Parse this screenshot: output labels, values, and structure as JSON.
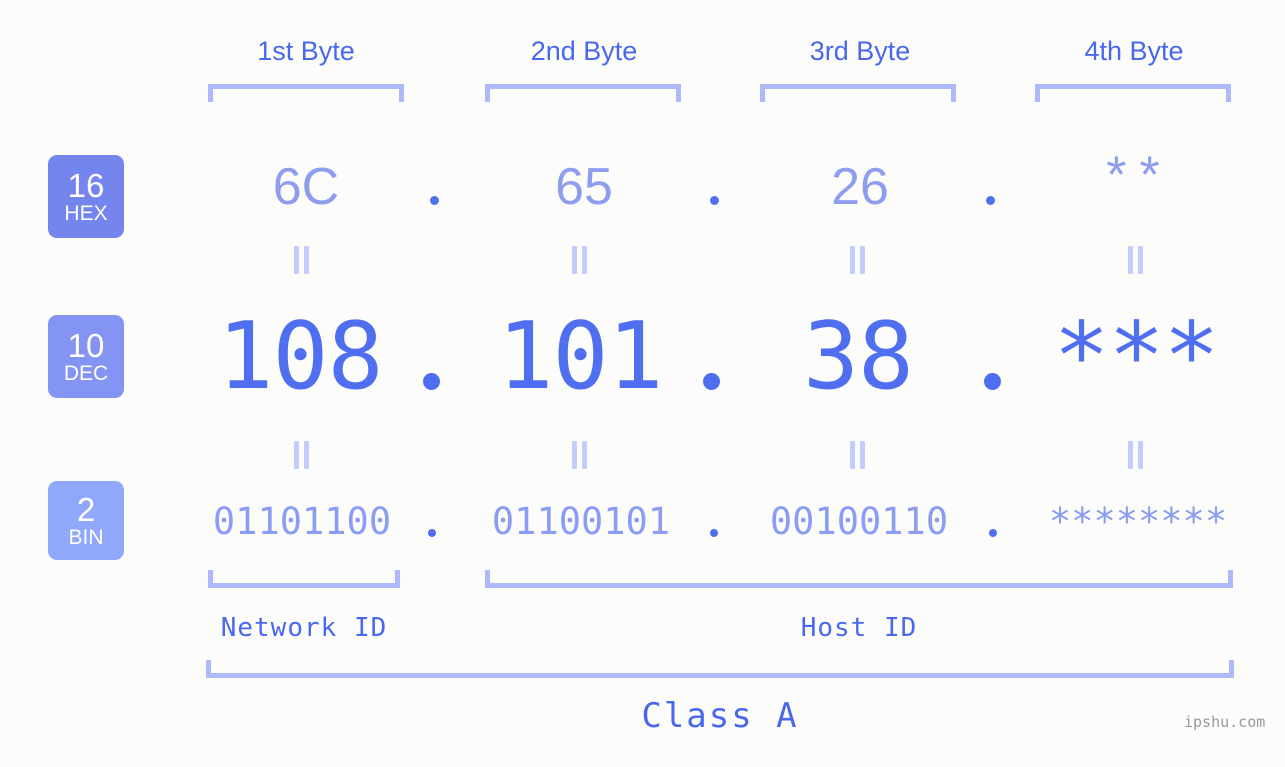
{
  "background_color": "#fcfdfa",
  "accent_color": "#4a68ee",
  "bracket_color": "#aeb9fb",
  "byte_headers": [
    {
      "label": "1st Byte"
    },
    {
      "label": "2nd Byte"
    },
    {
      "label": "3rd Byte"
    },
    {
      "label": "4th Byte"
    }
  ],
  "rows": {
    "hex": {
      "badge_number": "16",
      "badge_name": "HEX",
      "badge_color": "#7486ed",
      "values": [
        "6C",
        "65",
        "26",
        "**"
      ],
      "separator": "."
    },
    "dec": {
      "badge_number": "10",
      "badge_name": "DEC",
      "badge_color": "#8494f2",
      "values": [
        "108",
        "101",
        "38",
        "***"
      ],
      "separator": "."
    },
    "bin": {
      "badge_number": "2",
      "badge_name": "BIN",
      "badge_color": "#8fa8fb",
      "values": [
        "01101100",
        "01100101",
        "00100110",
        "********"
      ],
      "separator": "."
    }
  },
  "equals_marker": "||",
  "sections": {
    "network_id": "Network ID",
    "host_id": "Host ID",
    "class": "Class A"
  },
  "watermark": "ipshu.com"
}
